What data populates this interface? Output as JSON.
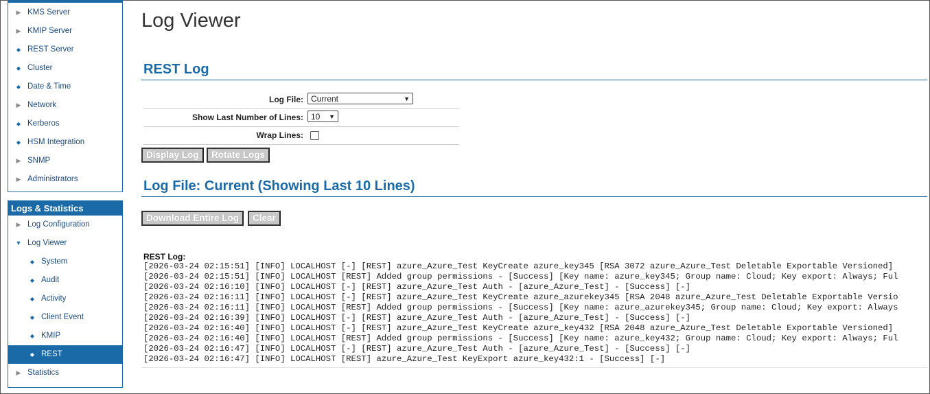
{
  "sidebar_config": {
    "items": [
      {
        "label": "KMS Server",
        "marker": "arrow"
      },
      {
        "label": "KMIP Server",
        "marker": "arrow"
      },
      {
        "label": "REST Server",
        "marker": "dot"
      },
      {
        "label": "Cluster",
        "marker": "dot"
      },
      {
        "label": "Date & Time",
        "marker": "dot"
      },
      {
        "label": "Network",
        "marker": "arrow"
      },
      {
        "label": "Kerberos",
        "marker": "dot"
      },
      {
        "label": "HSM Integration",
        "marker": "dot"
      },
      {
        "label": "SNMP",
        "marker": "arrow"
      },
      {
        "label": "Administrators",
        "marker": "arrow"
      }
    ]
  },
  "sidebar_logs": {
    "title": "Logs & Statistics",
    "items": [
      {
        "label": "Log Configuration",
        "marker": "arrow"
      },
      {
        "label": "Log Viewer",
        "marker": "open"
      },
      {
        "label": "System",
        "marker": "dot",
        "sub": true
      },
      {
        "label": "Audit",
        "marker": "dot",
        "sub": true
      },
      {
        "label": "Activity",
        "marker": "dot",
        "sub": true
      },
      {
        "label": "Client Event",
        "marker": "dot",
        "sub": true
      },
      {
        "label": "KMIP",
        "marker": "dot",
        "sub": true
      },
      {
        "label": "REST",
        "marker": "dot",
        "sub": true,
        "active": true
      },
      {
        "label": "Statistics",
        "marker": "arrow"
      }
    ]
  },
  "page": {
    "title": "Log Viewer",
    "section_rest_log": "REST Log",
    "section_log_file": "Log File: Current (Showing Last 10 Lines)"
  },
  "form": {
    "log_file_label": "Log File:",
    "log_file_value": "Current",
    "lines_label": "Show Last Number of Lines:",
    "lines_value": "10",
    "wrap_label": "Wrap Lines:",
    "wrap_checked": false
  },
  "buttons": {
    "display_log": "Display Log",
    "rotate_logs": "Rotate Logs",
    "download_log": "Download Entire Log",
    "clear": "Clear"
  },
  "log": {
    "heading": "REST Log:",
    "lines": [
      "[2026-03-24 02:15:51] [INFO] LOCALHOST [-] [REST] azure_Azure_Test KeyCreate azure_key345 [RSA 3072 azure_Azure_Test Deletable Exportable Versioned]",
      "[2026-03-24 02:15:51] [INFO] LOCALHOST [REST] Added group permissions - [Success] [Key name: azure_key345; Group name: Cloud; Key export: Always; Ful",
      "[2026-03-24 02:16:10] [INFO] LOCALHOST [-] [REST] azure_Azure_Test Auth - [azure_Azure_Test] - [Success] [-]",
      "[2026-03-24 02:16:11] [INFO] LOCALHOST [-] [REST] azure_Azure_Test KeyCreate azure_azurekey345 [RSA 2048 azure_Azure_Test Deletable Exportable Versio",
      "[2026-03-24 02:16:11] [INFO] LOCALHOST [REST] Added group permissions - [Success] [Key name: azure_azurekey345; Group name: Cloud; Key export: Always",
      "[2026-03-24 02:16:39] [INFO] LOCALHOST [-] [REST] azure_Azure_Test Auth - [azure_Azure_Test] - [Success] [-]",
      "[2026-03-24 02:16:40] [INFO] LOCALHOST [-] [REST] azure_Azure_Test KeyCreate azure_key432 [RSA 2048 azure_Azure_Test Deletable Exportable Versioned]",
      "[2026-03-24 02:16:40] [INFO] LOCALHOST [REST] Added group permissions - [Success] [Key name: azure_key432; Group name: Cloud; Key export: Always; Ful",
      "[2026-03-24 02:16:47] [INFO] LOCALHOST [-] [REST] azure_Azure_Test Auth - [azure_Azure_Test] - [Success] [-]",
      "[2026-03-24 02:16:47] [INFO] LOCALHOST [REST] azure_Azure_Test KeyExport azure_key432:1 - [Success] [-]"
    ]
  },
  "colors": {
    "accent": "#1a6aa8",
    "button_bg": "#c8c8c8"
  }
}
